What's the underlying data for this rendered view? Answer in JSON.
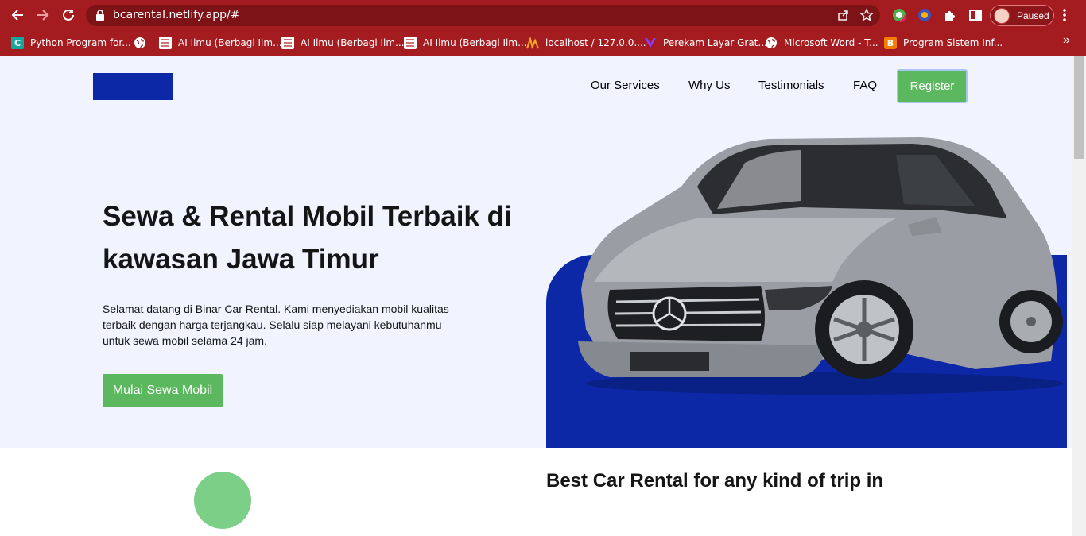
{
  "browser": {
    "url": "bcarental.netlify.app/#",
    "profile_status": "Paused",
    "bookmarks": [
      {
        "label": "Python Program for...",
        "icon": "c-letter-icon"
      },
      {
        "label": "",
        "icon": "globe-icon"
      },
      {
        "label": "AI Ilmu (Berbagi Ilm...",
        "icon": "doc-icon"
      },
      {
        "label": "AI Ilmu (Berbagi Ilm...",
        "icon": "doc-icon"
      },
      {
        "label": "AI Ilmu (Berbagi Ilm...",
        "icon": "doc-icon"
      },
      {
        "label": "localhost / 127.0.0....",
        "icon": "phpmyadmin-icon"
      },
      {
        "label": "Perekam Layar Grat...",
        "icon": "v-logo-icon"
      },
      {
        "label": "Microsoft Word - T...",
        "icon": "globe-icon"
      },
      {
        "label": "Program Sistem Inf...",
        "icon": "blogger-icon"
      }
    ],
    "more_bookmarks": "»"
  },
  "site": {
    "nav": [
      "Our Services",
      "Why Us",
      "Testimonials",
      "FAQ"
    ],
    "register_label": "Register",
    "hero_title": "Sewa & Rental Mobil Terbaik di kawasan Jawa Timur",
    "hero_desc": "Selamat datang di Binar Car Rental. Kami menyediakan mobil kualitas terbaik dengan harga terjangkau. Selalu siap melayani kebutuhanmu untuk sewa mobil selama 24 jam.",
    "cta_label": "Mulai Sewa Mobil",
    "next_section_title": "Best Car Rental for any kind of trip in"
  },
  "colors": {
    "chrome": "#a51c20",
    "brand_blue": "#0d28a6",
    "accent_green": "#5cb85f",
    "hero_bg": "#f1f3ff"
  }
}
